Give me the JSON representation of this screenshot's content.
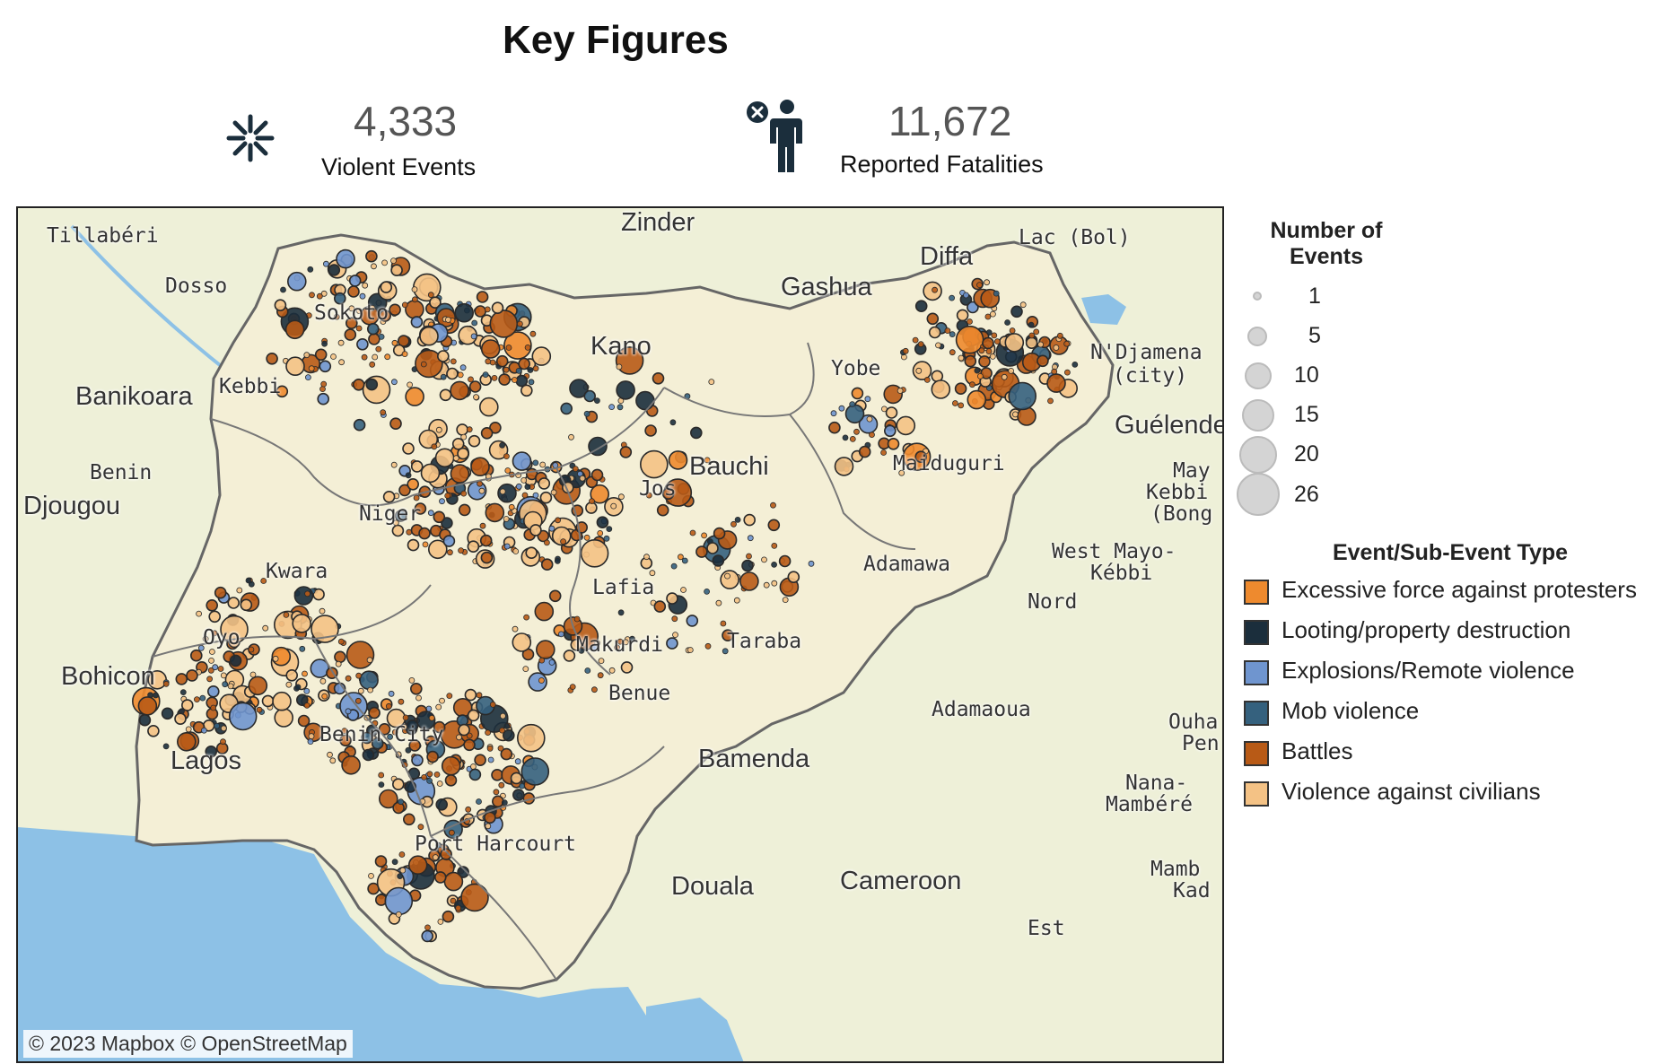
{
  "header": {
    "title": "Key Figures",
    "events_value": "4,333",
    "events_label": "Violent Events",
    "fatalities_value": "11,672",
    "fatalities_label": "Reported Fatalities"
  },
  "map": {
    "credit": "© 2023 Mapbox © OpenStreetMap",
    "labels": [
      {
        "text": "Tillabéri"
      },
      {
        "text": "Zinder"
      },
      {
        "text": "Lac (Bol)"
      },
      {
        "text": "Diffa"
      },
      {
        "text": "Dosso"
      },
      {
        "text": "Gashua"
      },
      {
        "text": "Sokoto"
      },
      {
        "text": "Kano"
      },
      {
        "text": "N'Djamena"
      },
      {
        "text": "(city)"
      },
      {
        "text": "Yobe"
      },
      {
        "text": "Banikoara"
      },
      {
        "text": "Kebbi"
      },
      {
        "text": "Guélende"
      },
      {
        "text": "Bauchi"
      },
      {
        "text": "Benin"
      },
      {
        "text": "Maiduguri"
      },
      {
        "text": "May"
      },
      {
        "text": "Kebbi"
      },
      {
        "text": "(Bong"
      },
      {
        "text": "Djougou"
      },
      {
        "text": "Niger"
      },
      {
        "text": "Jos"
      },
      {
        "text": "Kwara"
      },
      {
        "text": "Adamawa"
      },
      {
        "text": "West Mayo-"
      },
      {
        "text": "Kébbi"
      },
      {
        "text": "Lafia"
      },
      {
        "text": "Nord"
      },
      {
        "text": "Oyo"
      },
      {
        "text": "Makurdi"
      },
      {
        "text": "Taraba"
      },
      {
        "text": "Bohicon"
      },
      {
        "text": "Benue"
      },
      {
        "text": "Adamaoua"
      },
      {
        "text": "Lagos"
      },
      {
        "text": "Benin City"
      },
      {
        "text": "Ouha"
      },
      {
        "text": "Pen"
      },
      {
        "text": "Bamenda"
      },
      {
        "text": "Nana-"
      },
      {
        "text": "Mambéré"
      },
      {
        "text": "Douala"
      },
      {
        "text": "Cameroon"
      },
      {
        "text": "Mamb"
      },
      {
        "text": "Kad"
      },
      {
        "text": "Est"
      },
      {
        "text": "Port Harcourt"
      }
    ]
  },
  "legend": {
    "size_title": "Number of Events",
    "sizes": [
      {
        "value": 1,
        "label": "1"
      },
      {
        "value": 5,
        "label": "5"
      },
      {
        "value": 10,
        "label": "10"
      },
      {
        "value": 15,
        "label": "15"
      },
      {
        "value": 20,
        "label": "20"
      },
      {
        "value": 26,
        "label": "26"
      }
    ],
    "type_title": "Event/Sub-Event Type",
    "types": [
      {
        "label": "Excessive force against protesters",
        "color": "#ee8a2e"
      },
      {
        "label": "Looting/property destruction",
        "color": "#1b2e3c"
      },
      {
        "label": "Explosions/Remote violence",
        "color": "#6f95cf"
      },
      {
        "label": "Mob violence",
        "color": "#35617e"
      },
      {
        "label": "Battles",
        "color": "#b85a16"
      },
      {
        "label": "Violence against civilians",
        "color": "#f4c285"
      }
    ]
  },
  "colors": {
    "water": "#8dc1e6",
    "land": "#eef0d8",
    "nigeria_fill": "#f4efd6",
    "border": "#666666"
  },
  "icons": {
    "events_icon": "burst-icon",
    "fatalities_icon": "person-x-icon"
  }
}
